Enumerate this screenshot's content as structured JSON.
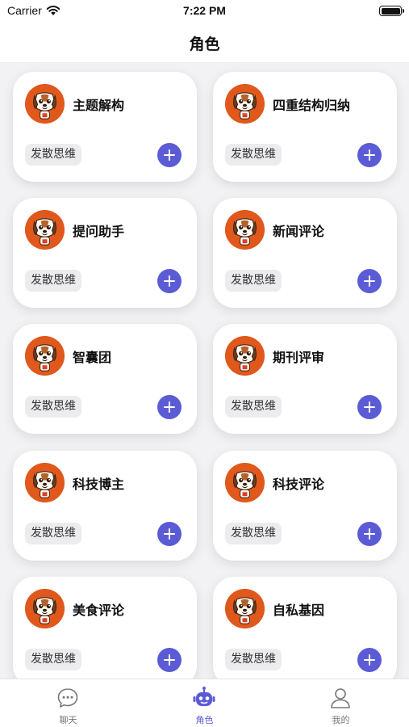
{
  "status_bar": {
    "carrier": "Carrier",
    "time": "7:22 PM"
  },
  "nav": {
    "title": "角色"
  },
  "roles": [
    {
      "name": "主题解构",
      "tag": "发散思维"
    },
    {
      "name": "四重结构归纳",
      "tag": "发散思维"
    },
    {
      "name": "提问助手",
      "tag": "发散思维"
    },
    {
      "name": "新闻评论",
      "tag": "发散思维"
    },
    {
      "name": "智囊团",
      "tag": "发散思维"
    },
    {
      "name": "期刊评审",
      "tag": "发散思维"
    },
    {
      "name": "科技博主",
      "tag": "发散思维"
    },
    {
      "name": "科技评论",
      "tag": "发散思维"
    },
    {
      "name": "美食评论",
      "tag": "发散思维"
    },
    {
      "name": "自私基因",
      "tag": "发散思维"
    }
  ],
  "tabs": [
    {
      "label": "聊天",
      "icon": "chat-bubble-icon",
      "active": false
    },
    {
      "label": "角色",
      "icon": "robot-icon",
      "active": true
    },
    {
      "label": "我的",
      "icon": "person-icon",
      "active": false
    }
  ],
  "colors": {
    "accent": "#5b5bd6",
    "avatar_bg": "#e0581c",
    "tag_bg": "#ececee",
    "page_bg": "#f2f2f4"
  }
}
